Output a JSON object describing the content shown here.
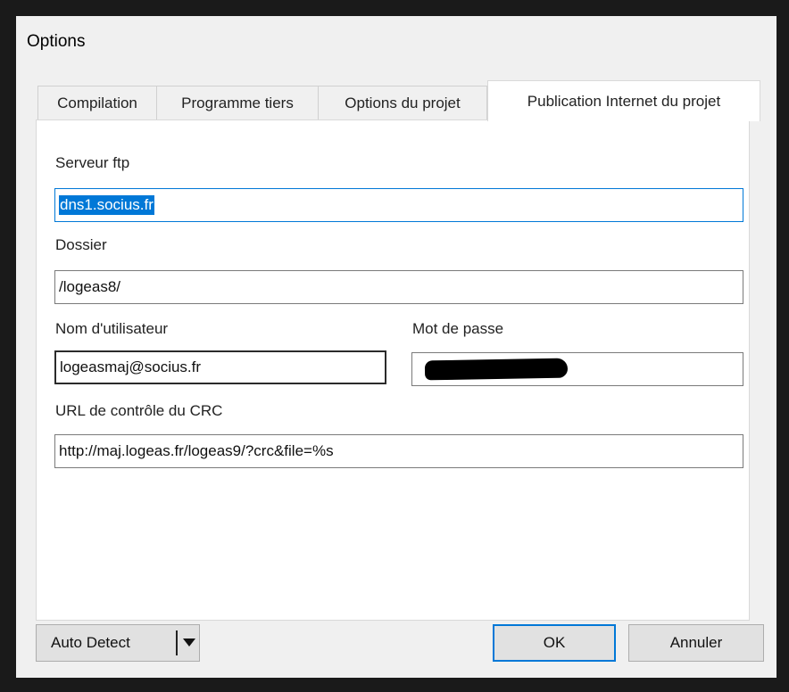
{
  "window": {
    "title": "Options"
  },
  "tabs": [
    {
      "label": "Compilation",
      "active": false
    },
    {
      "label": "Programme tiers",
      "active": false
    },
    {
      "label": "Options du projet",
      "active": false
    },
    {
      "label": "Publication Internet du projet",
      "active": true
    }
  ],
  "form": {
    "ftp_server": {
      "label": "Serveur ftp",
      "value": "dns1.socius.fr"
    },
    "folder": {
      "label": "Dossier",
      "value": "/logeas8/"
    },
    "username": {
      "label": "Nom d'utilisateur",
      "value": "logeasmaj@socius.fr"
    },
    "password": {
      "label": "Mot de passe",
      "value": ""
    },
    "crc_url": {
      "label": "URL de contrôle du CRC",
      "value": "http://maj.logeas.fr/logeas9/?crc&file=%s"
    }
  },
  "buttons": {
    "auto_detect": "Auto Detect",
    "ok": "OK",
    "cancel": "Annuler"
  },
  "colors": {
    "selection": "#0078d7",
    "focus_border": "#0078d7"
  }
}
